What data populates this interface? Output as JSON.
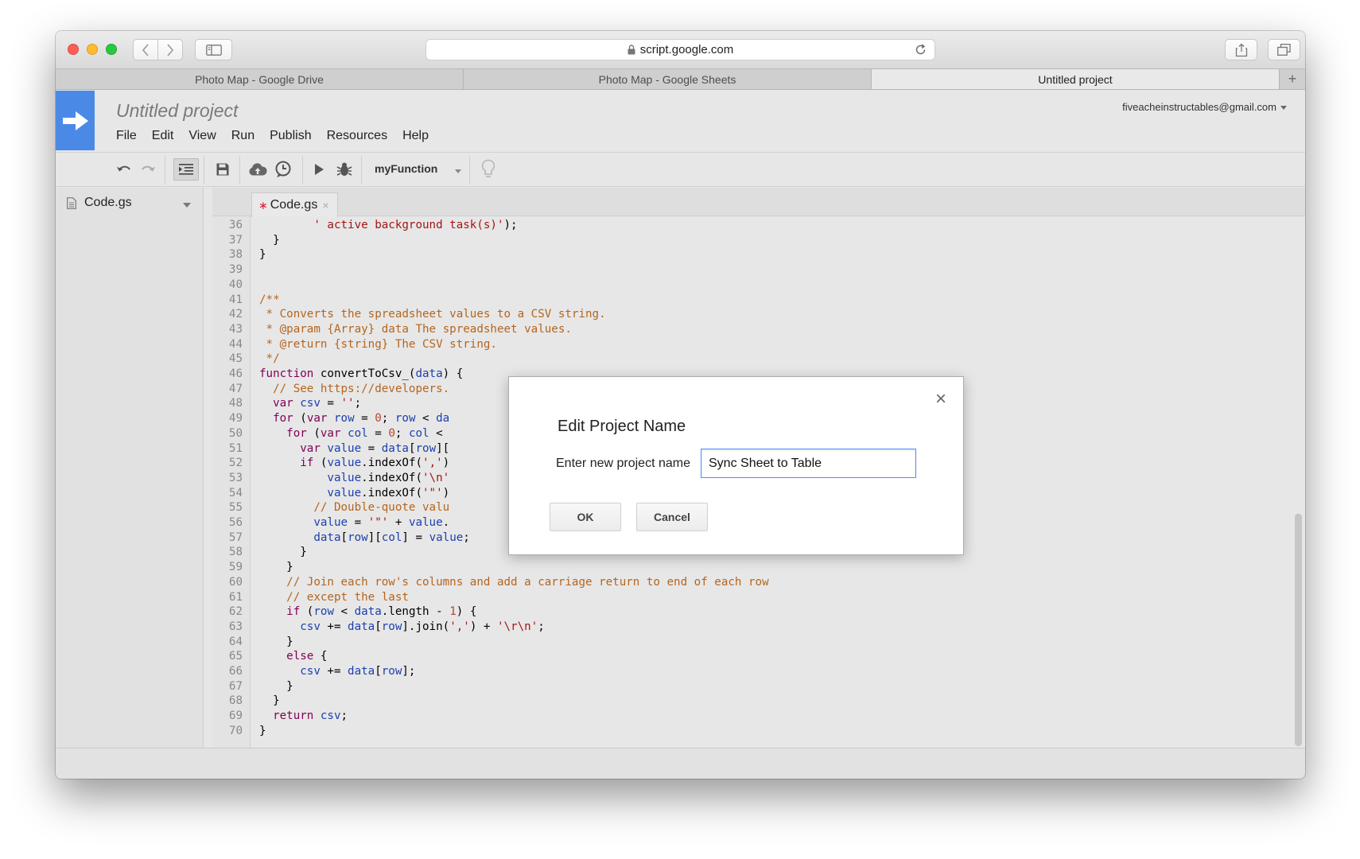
{
  "browser": {
    "url": "script.google.com",
    "tabs": [
      {
        "title": "Photo Map - Google Drive",
        "active": false
      },
      {
        "title": "Photo Map - Google Sheets",
        "active": false
      },
      {
        "title": "Untitled project",
        "active": true
      }
    ],
    "new_tab_label": "+"
  },
  "app": {
    "project_title": "Untitled project",
    "account": "fiveacheinstructables@gmail.com",
    "menu": [
      "File",
      "Edit",
      "View",
      "Run",
      "Publish",
      "Resources",
      "Help"
    ],
    "toolbar": {
      "function_select": "myFunction",
      "icons": [
        "undo-icon",
        "redo-icon",
        "indent-icon",
        "save-icon",
        "deploy-cloud-icon",
        "triggers-clock-icon",
        "run-play-icon",
        "debug-bug-icon",
        "lightbulb-icon"
      ]
    },
    "files": [
      {
        "name": "Code.gs"
      }
    ],
    "editor_tab": {
      "name": "Code.gs",
      "modified_mark": "∗",
      "close_mark": "×"
    }
  },
  "code_lines": [
    {
      "n": "36",
      "html": "        <span class=\"str\">' active background task(s)'</span>);"
    },
    {
      "n": "37",
      "html": "  }"
    },
    {
      "n": "38",
      "html": "}"
    },
    {
      "n": "39",
      "html": ""
    },
    {
      "n": "40",
      "html": ""
    },
    {
      "n": "41",
      "html": "<span class=\"cm\">/**</span>"
    },
    {
      "n": "42",
      "html": "<span class=\"cm\"> * Converts the spreadsheet values to a CSV string.</span>"
    },
    {
      "n": "43",
      "html": "<span class=\"cm\"> * @param {Array} data The spreadsheet values.</span>"
    },
    {
      "n": "44",
      "html": "<span class=\"cm\"> * @return {string} The CSV string.</span>"
    },
    {
      "n": "45",
      "html": "<span class=\"cm\"> */</span>"
    },
    {
      "n": "46",
      "html": "<span class=\"kw\">function</span> convertToCsv_(<span class=\"vr\">data</span>) {"
    },
    {
      "n": "47",
      "html": "  <span class=\"cm\">// See https://developers.</span>"
    },
    {
      "n": "48",
      "html": "  <span class=\"kw\">var</span> <span class=\"vr\">csv</span> = <span class=\"str\">''</span>;"
    },
    {
      "n": "49",
      "html": "  <span class=\"kw\">for</span> (<span class=\"kw\">var</span> <span class=\"vr\">row</span> = <span class=\"num\">0</span>; <span class=\"vr\">row</span> &lt; <span class=\"vr\">da</span>"
    },
    {
      "n": "50",
      "html": "    <span class=\"kw\">for</span> (<span class=\"kw\">var</span> <span class=\"vr\">col</span> = <span class=\"num\">0</span>; <span class=\"vr\">col</span> &lt;"
    },
    {
      "n": "51",
      "html": "      <span class=\"kw\">var</span> <span class=\"vr\">value</span> = <span class=\"vr\">data</span>[<span class=\"vr\">row</span>]["
    },
    {
      "n": "52",
      "html": "      <span class=\"kw\">if</span> (<span class=\"vr\">value</span>.indexOf(<span class=\"str\">','</span>)"
    },
    {
      "n": "53",
      "html": "          <span class=\"vr\">value</span>.indexOf(<span class=\"str\">'\\n'</span>"
    },
    {
      "n": "54",
      "html": "          <span class=\"vr\">value</span>.indexOf(<span class=\"str\">'\"'</span>)"
    },
    {
      "n": "55",
      "html": "        <span class=\"cm\">// Double-quote valu</span>"
    },
    {
      "n": "56",
      "html": "        <span class=\"vr\">value</span> = <span class=\"str\">'\"'</span> + <span class=\"vr\">value</span>."
    },
    {
      "n": "57",
      "html": "        <span class=\"vr\">data</span>[<span class=\"vr\">row</span>][<span class=\"vr\">col</span>] = <span class=\"vr\">value</span>;"
    },
    {
      "n": "58",
      "html": "      }"
    },
    {
      "n": "59",
      "html": "    }"
    },
    {
      "n": "60",
      "html": "    <span class=\"cm\">// Join each row's columns and add a carriage return to end of each row</span>"
    },
    {
      "n": "61",
      "html": "    <span class=\"cm\">// except the last</span>"
    },
    {
      "n": "62",
      "html": "    <span class=\"kw\">if</span> (<span class=\"vr\">row</span> &lt; <span class=\"vr\">data</span>.length - <span class=\"num\">1</span>) {"
    },
    {
      "n": "63",
      "html": "      <span class=\"vr\">csv</span> += <span class=\"vr\">data</span>[<span class=\"vr\">row</span>].join(<span class=\"str\">','</span>) + <span class=\"str\">'\\r\\n'</span>;"
    },
    {
      "n": "64",
      "html": "    }"
    },
    {
      "n": "65",
      "html": "    <span class=\"kw\">else</span> {"
    },
    {
      "n": "66",
      "html": "      <span class=\"vr\">csv</span> += <span class=\"vr\">data</span>[<span class=\"vr\">row</span>];"
    },
    {
      "n": "67",
      "html": "    }"
    },
    {
      "n": "68",
      "html": "  }"
    },
    {
      "n": "69",
      "html": "  <span class=\"kw\">return</span> <span class=\"vr\">csv</span>;"
    },
    {
      "n": "70",
      "html": "}"
    }
  ],
  "dialog": {
    "title": "Edit Project Name",
    "label": "Enter new project name",
    "input_value": "Sync Sheet to Table",
    "ok_label": "OK",
    "cancel_label": "Cancel",
    "close_label": "×"
  },
  "colors": {
    "apps_logo": "#4a8ae6",
    "input_focus": "#4d90fe",
    "keyword": "#7f0055",
    "string": "#a31515",
    "comment": "#b5651d",
    "variable": "#1c3fae"
  }
}
